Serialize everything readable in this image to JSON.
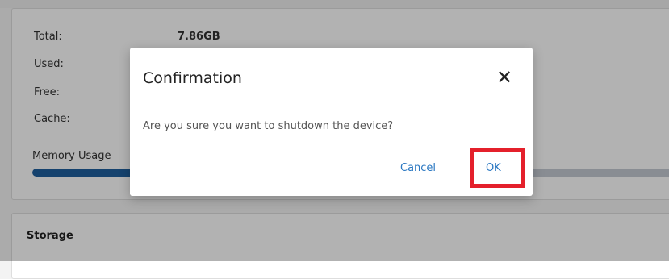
{
  "memory": {
    "total_label": "Total:",
    "total_value": "7.86GB",
    "used_label": "Used:",
    "free_label": "Free:",
    "cache_label": "Cache:",
    "usage_label": "Memory Usage",
    "usage_fraction": 0.22,
    "bar_color": "#1f5f9e",
    "track_color": "#c4cbd3"
  },
  "storage": {
    "title": "Storage"
  },
  "dialog": {
    "title": "Confirmation",
    "close_icon": "close-icon",
    "message": "Are you sure you want to shutdown the device?",
    "cancel_label": "Cancel",
    "ok_label": "OK",
    "highlight_color": "#e4202b",
    "link_color": "#2b78c2"
  }
}
